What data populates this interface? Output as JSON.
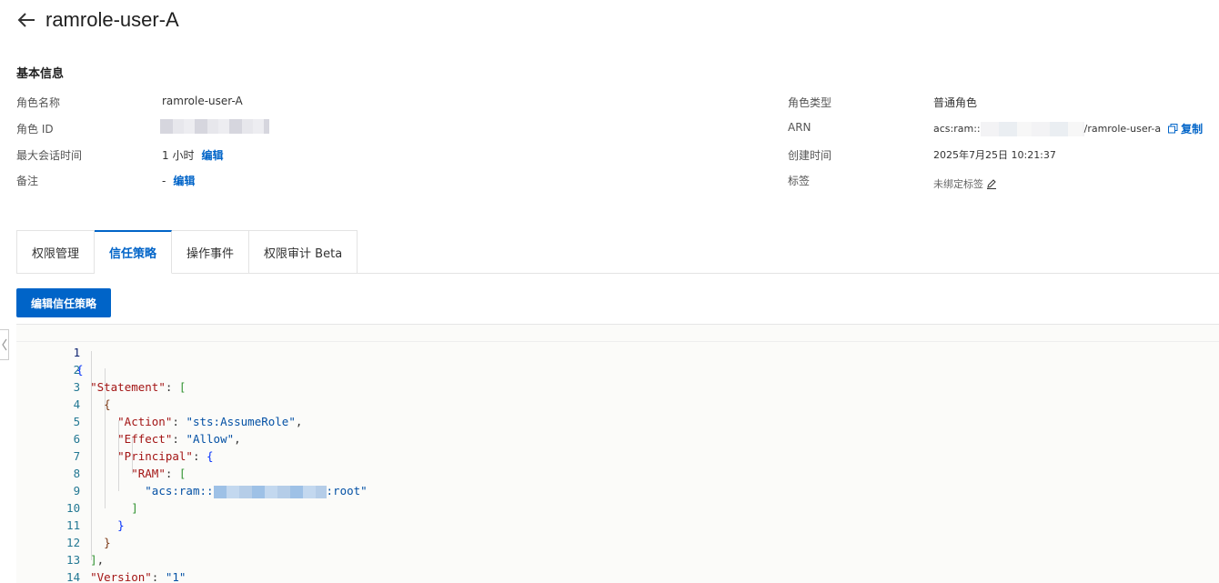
{
  "header": {
    "title": "ramrole-user-A"
  },
  "basic_info": {
    "section_title": "基本信息",
    "left": [
      {
        "label": "角色名称",
        "value": "ramrole-user-A"
      },
      {
        "label": "角色 ID",
        "value": ""
      },
      {
        "label": "最大会话时间",
        "value": "1 小时",
        "action": "编辑"
      },
      {
        "label": "备注",
        "value": "-",
        "action": "编辑"
      }
    ],
    "right": [
      {
        "label": "角色类型",
        "value": "普通角色"
      },
      {
        "label": "ARN",
        "value_prefix": "acs:ram::",
        "value_suffix": "/ramrole-user-a",
        "action": "复制"
      },
      {
        "label": "创建时间",
        "value": "2025年7月25日 10:21:37"
      },
      {
        "label": "标签",
        "value": "未绑定标签"
      }
    ]
  },
  "tabs": [
    {
      "label": "权限管理",
      "active": false
    },
    {
      "label": "信任策略",
      "active": true
    },
    {
      "label": "操作事件",
      "active": false
    },
    {
      "label": "权限审计 Beta",
      "active": false
    }
  ],
  "edit_button": "编辑信任策略",
  "editor": {
    "line_numbers": [
      "1",
      "2",
      "3",
      "4",
      "5",
      "6",
      "7",
      "8",
      "9",
      "10",
      "11",
      "12",
      "13",
      "14"
    ],
    "keys": {
      "statement": "\"Statement\"",
      "action": "\"Action\"",
      "effect": "\"Effect\"",
      "principal": "\"Principal\"",
      "ram": "\"RAM\"",
      "version": "\"Version\""
    },
    "values": {
      "action": "\"sts:AssumeRole\"",
      "effect": "\"Allow\"",
      "ram_prefix": "\"acs:ram::",
      "ram_suffix": ":root\"",
      "version": "\"1\""
    }
  },
  "colors": {
    "accent": "#0064c8",
    "json_key": "#a31515",
    "json_string": "#0451a5"
  }
}
